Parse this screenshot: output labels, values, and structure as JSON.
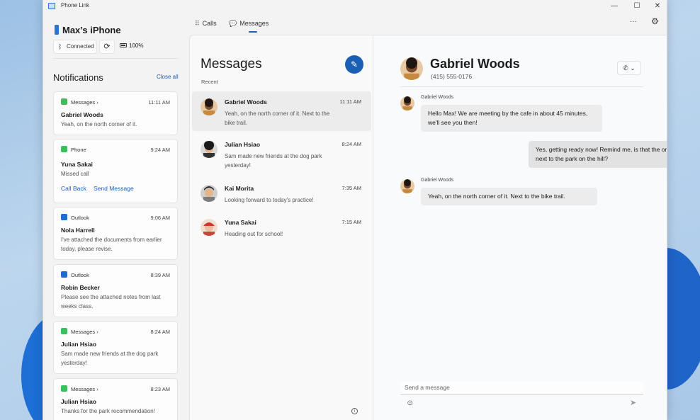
{
  "window": {
    "title": "Phone Link",
    "controls": {
      "minimize": "—",
      "maximize": "☐",
      "close": "✕"
    }
  },
  "device": {
    "name": "Max’s iPhone",
    "connection_status": "Connected",
    "sync_icon": "sync-icon",
    "battery": "100%"
  },
  "notifications": {
    "title": "Notifications",
    "close_all": "Close all",
    "items": [
      {
        "app": "Messages",
        "chevron": "›",
        "time": "11:11 AM",
        "name": "Gabriel Woods",
        "text": "Yeah, on the north corner of it."
      },
      {
        "app": "Phone",
        "time": "9:24 AM",
        "name": "Yuna Sakai",
        "text": "Missed call",
        "actions": [
          "Call Back",
          "Send Message"
        ]
      },
      {
        "app": "Outlook",
        "time": "9:06 AM",
        "name": "Nola Harrell",
        "text": "I've attached the documents from earlier today, please revise."
      },
      {
        "app": "Outlook",
        "time": "8:39 AM",
        "name": "Robin Becker",
        "text": "Please see the attached notes from last weeks class."
      },
      {
        "app": "Messages",
        "chevron": "›",
        "time": "8:24 AM",
        "name": "Julian Hsiao",
        "text": "Sam made new friends at the dog park yesterday!"
      },
      {
        "app": "Messages",
        "chevron": "›",
        "time": "8:23 AM",
        "name": "Julian Hsiao",
        "text": "Thanks for the park recommendation!"
      }
    ]
  },
  "tabs": [
    {
      "label": "Calls",
      "icon": "dialpad-icon"
    },
    {
      "label": "Messages",
      "icon": "chat-icon",
      "active": true
    }
  ],
  "toolbar": {
    "more": "···",
    "settings_icon": "gear-icon"
  },
  "messages_list": {
    "title": "Messages",
    "section": "Recent",
    "compose_icon": "compose-icon",
    "conversations": [
      {
        "name": "Gabriel Woods",
        "time": "11:11 AM",
        "preview": "Yeah, on the north corner of it. Next to the bike trail.",
        "selected": true
      },
      {
        "name": "Julian Hsiao",
        "time": "8:24 AM",
        "preview": "Sam made new friends at the dog park yesterday!"
      },
      {
        "name": "Kai Morita",
        "time": "7:35 AM",
        "preview": "Looking forward to today's practice!"
      },
      {
        "name": "Yuna Sakai",
        "time": "7:15 AM",
        "preview": "Heading out for school!"
      }
    ]
  },
  "chat": {
    "contact_name": "Gabriel Woods",
    "contact_phone": "(415) 555-0176",
    "call_icon": "phone-icon",
    "messages": [
      {
        "sender": "Gabriel Woods",
        "direction": "in",
        "text": "Hello Max! We are meeting by the cafe in about 45 minutes, we'll see you then!"
      },
      {
        "direction": "out",
        "text": "Yes, getting ready now! Remind me, is that the one next to the park on the hill?"
      },
      {
        "sender": "Gabriel Woods",
        "direction": "in",
        "text": "Yeah, on the north corner of it. Next to the bike trail."
      }
    ],
    "compose_placeholder": "Send a message"
  },
  "colors": {
    "accent": "#1a5fb4",
    "messages_app": "#3cbf5b",
    "outlook_app": "#1f6bd1"
  }
}
